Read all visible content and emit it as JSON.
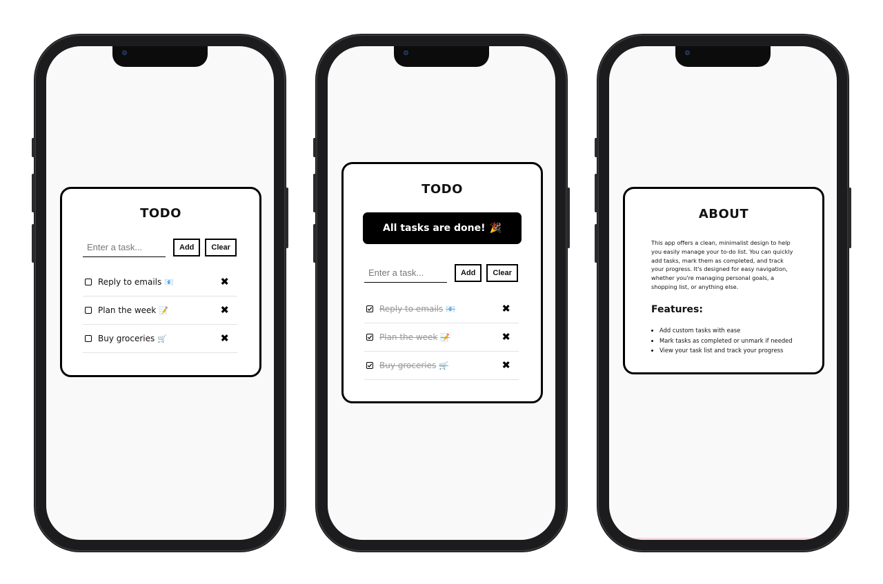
{
  "screens": [
    {
      "title": "TODO",
      "input": {
        "placeholder": "Enter a task...",
        "value": ""
      },
      "buttons": {
        "add": "Add",
        "clear": "Clear"
      },
      "tasks": [
        {
          "text": "Reply to emails",
          "emoji": "📧",
          "done": false
        },
        {
          "text": "Plan the week",
          "emoji": "📝",
          "done": false
        },
        {
          "text": "Buy groceries",
          "emoji": "🛒",
          "done": false
        }
      ],
      "delete_glyph": "✖"
    },
    {
      "title": "TODO",
      "banner": {
        "text": "All tasks are done!",
        "emoji": "🎉"
      },
      "input": {
        "placeholder": "Enter a task...",
        "value": ""
      },
      "buttons": {
        "add": "Add",
        "clear": "Clear"
      },
      "tasks": [
        {
          "text": "Reply to emails",
          "emoji": "📧",
          "done": true
        },
        {
          "text": "Plan the week",
          "emoji": "📝",
          "done": true
        },
        {
          "text": "Buy groceries",
          "emoji": "🛒",
          "done": true
        }
      ],
      "delete_glyph": "✖"
    },
    {
      "title": "ABOUT",
      "description": "This app offers a clean, minimalist design to help you easily manage your to-do list. You can quickly add tasks, mark them as completed, and track your progress. It's designed for easy navigation, whether you're managing personal goals, a shopping list, or anything else.",
      "features_title": "Features:",
      "features": [
        "Add custom tasks with ease",
        "Mark tasks as completed or unmark if needed",
        "View your task list and track your progress"
      ]
    }
  ],
  "colors": {
    "card_border": "#000000",
    "screen_bg": "#f9f9f9",
    "banner_bg": "#000000",
    "done_text": "#999999"
  },
  "icons": {
    "unchecked": "checkbox-empty-icon",
    "checked": "checkbox-checked-icon",
    "delete": "close-x-icon"
  }
}
